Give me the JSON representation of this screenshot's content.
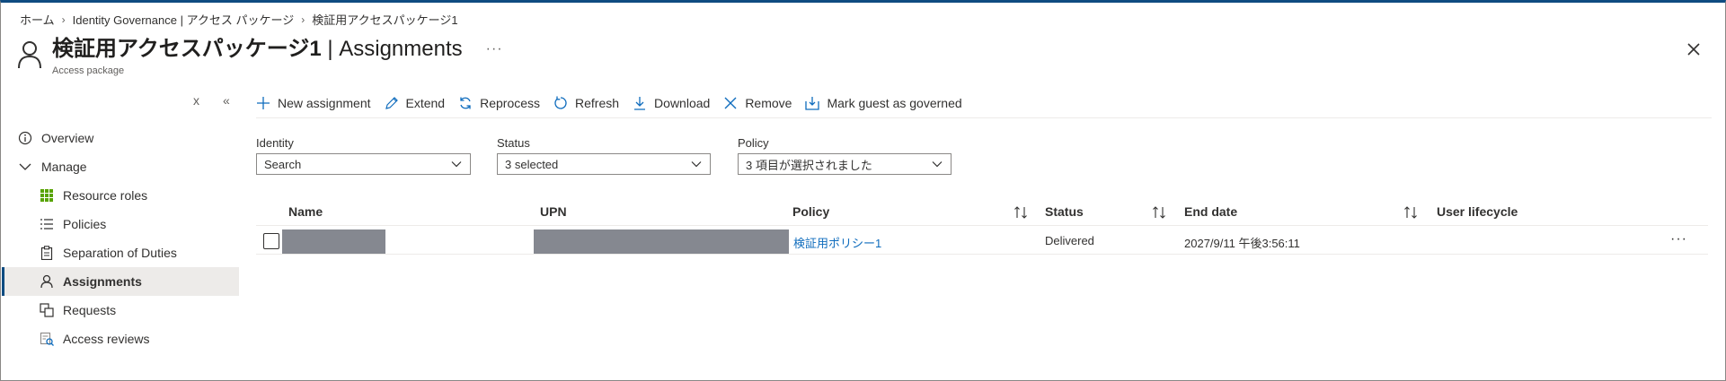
{
  "breadcrumb": [
    {
      "label": "ホーム"
    },
    {
      "label": "Identity Governance | アクセス パッケージ"
    },
    {
      "label": "検証用アクセスパッケージ1"
    }
  ],
  "header": {
    "title_name": "検証用アクセスパッケージ1",
    "title_section": " | Assignments",
    "subtitle": "Access package",
    "more": "···"
  },
  "sidebar": {
    "collapse_all": "x",
    "collapse_panel": "«",
    "items": [
      {
        "label": "Overview",
        "icon": "info-icon"
      },
      {
        "label": "Manage",
        "icon": "chevron-down-icon"
      },
      {
        "label": "Resource roles",
        "icon": "grid-icon"
      },
      {
        "label": "Policies",
        "icon": "list-icon"
      },
      {
        "label": "Separation of Duties",
        "icon": "clipboard-icon"
      },
      {
        "label": "Assignments",
        "icon": "person-icon",
        "active": true
      },
      {
        "label": "Requests",
        "icon": "requests-icon"
      },
      {
        "label": "Access reviews",
        "icon": "access-review-icon"
      }
    ]
  },
  "toolbar": {
    "new_assignment": "New assignment",
    "extend": "Extend",
    "reprocess": "Reprocess",
    "refresh": "Refresh",
    "download": "Download",
    "remove": "Remove",
    "mark_guest": "Mark guest as governed"
  },
  "filters": {
    "identity": {
      "label": "Identity",
      "value": "Search"
    },
    "status": {
      "label": "Status",
      "value": "3 selected"
    },
    "policy": {
      "label": "Policy",
      "value": "3 項目が選択されました"
    }
  },
  "table": {
    "columns": [
      "Name",
      "UPN",
      "Policy",
      "Status",
      "End date",
      "User lifecycle"
    ],
    "rows": [
      {
        "name": "",
        "upn": "",
        "policy": "検証用ポリシー1",
        "status": "Delivered",
        "end_date": "2027/9/11 午後3:56:11",
        "user_lifecycle": "",
        "more": "···"
      }
    ]
  },
  "colors": {
    "accent": "#0f6cbd",
    "nav_active_bg": "#edebe9",
    "redaction": "#858890",
    "top_border": "#0f4c81"
  }
}
